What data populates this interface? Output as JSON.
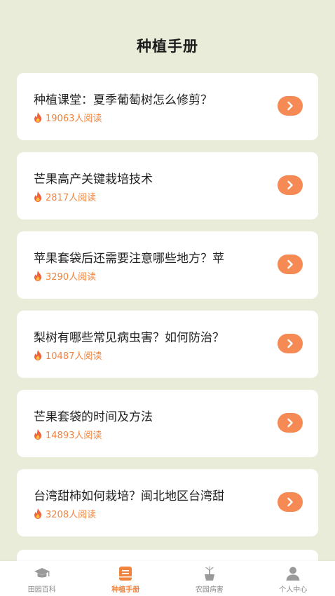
{
  "header": {
    "title": "种植手册"
  },
  "articles": [
    {
      "title": "种植课堂：夏季葡萄树怎么修剪？",
      "reads": "19063人阅读"
    },
    {
      "title": "芒果高产关键栽培技术",
      "reads": "2817人阅读"
    },
    {
      "title": "苹果套袋后还需要注意哪些地方？苹",
      "reads": "3290人阅读"
    },
    {
      "title": "梨树有哪些常见病虫害？如何防治？",
      "reads": "10487人阅读"
    },
    {
      "title": "芒果套袋的时间及方法",
      "reads": "14893人阅读"
    },
    {
      "title": "台湾甜柿如何栽培？闽北地区台湾甜",
      "reads": "3208人阅读"
    }
  ],
  "tabbar": {
    "items": [
      {
        "label": "田园百科",
        "icon": "graduation-cap-icon"
      },
      {
        "label": "种植手册",
        "icon": "book-icon"
      },
      {
        "label": "农园病害",
        "icon": "plant-pot-icon"
      },
      {
        "label": "个人中心",
        "icon": "person-icon"
      }
    ],
    "active_index": 1
  },
  "colors": {
    "background": "#e8ecd9",
    "accent": "#f68a55",
    "read_count": "#f0843f"
  }
}
